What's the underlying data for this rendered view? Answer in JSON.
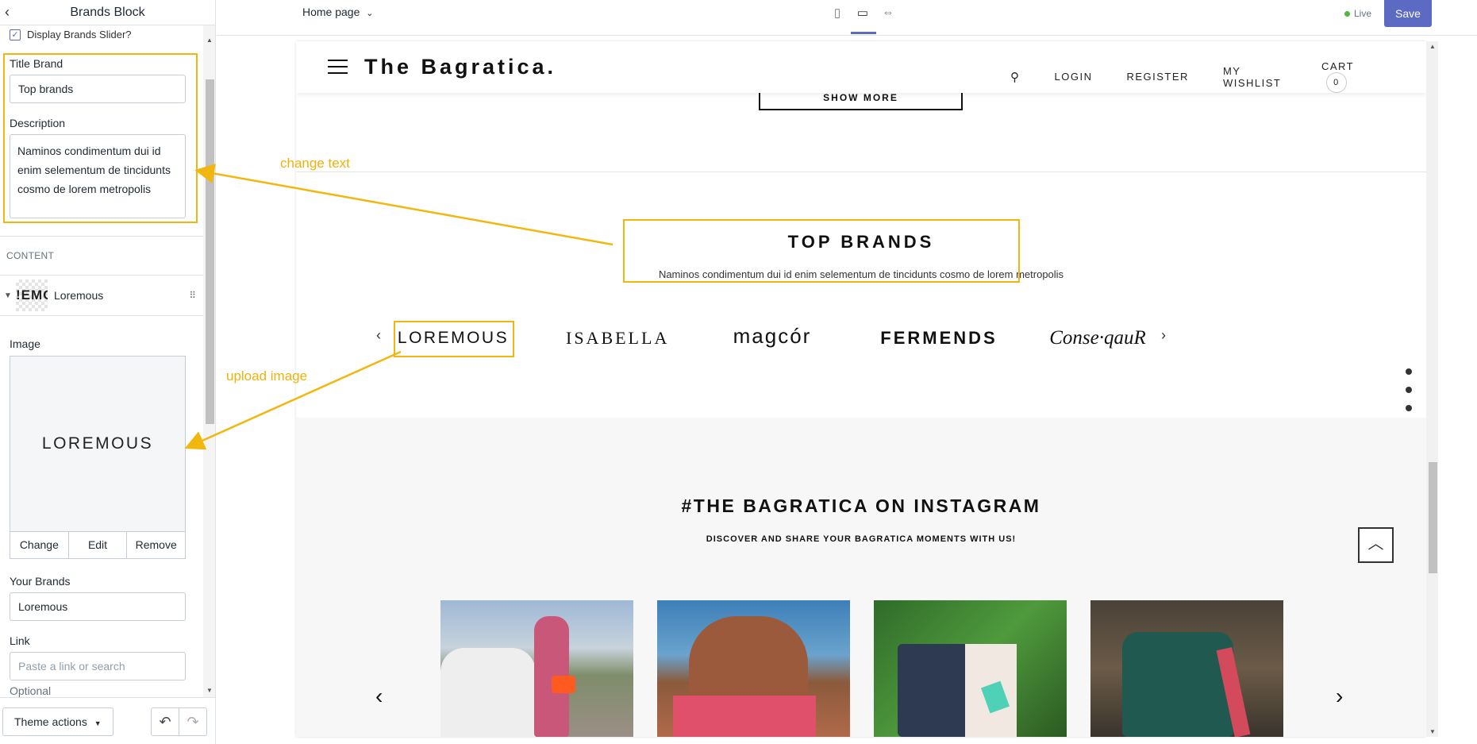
{
  "sidebar": {
    "title": "Brands Block",
    "display_slider_label": "Display Brands Slider?",
    "title_brand_label": "Title Brand",
    "title_brand_value": "Top brands",
    "description_label": "Description",
    "description_value": "Naminos condimentum dui id enim selementum de tincidunts cosmo de lorem metropolis",
    "content_label": "CONTENT",
    "block_thumb_text": "!EMO",
    "block_name": "Loremous",
    "image_label": "Image",
    "image_preview_text": "LOREMOUS",
    "btn_change": "Change",
    "btn_edit": "Edit",
    "btn_remove": "Remove",
    "your_brands_label": "Your Brands",
    "your_brands_value": "Loremous",
    "link_label": "Link",
    "link_placeholder": "Paste a link or search",
    "optional_label": "Optional",
    "theme_actions": "Theme actions"
  },
  "topbar": {
    "page_select": "Home page",
    "live": "Live",
    "save": "Save"
  },
  "preview": {
    "logo": "The Bagratica.",
    "nav": {
      "login": "LOGIN",
      "register": "REGISTER",
      "wishlist": "MY WISHLIST",
      "cart": "CART",
      "cart_count": "0"
    },
    "show_more": "SHOW MORE",
    "top_brands_title": "TOP BRANDS",
    "top_brands_desc": "Naminos condimentum dui id enim selementum de tincidunts cosmo de lorem metropolis",
    "brands": [
      "LOREMOUS",
      "ISABELLA",
      "magcór",
      "FERMENDS",
      "Conse·qauR"
    ],
    "instagram_title": "#THE BAGRATICA ON INSTAGRAM",
    "instagram_sub": "DISCOVER AND SHARE YOUR BAGRATICA MOMENTS WITH US!"
  },
  "annotations": {
    "change_text": "change text",
    "upload_image": "upload image"
  },
  "colors": {
    "accent": "#5c6ac4",
    "annotation": "#f2b70e",
    "live_dot": "#50b83c"
  }
}
